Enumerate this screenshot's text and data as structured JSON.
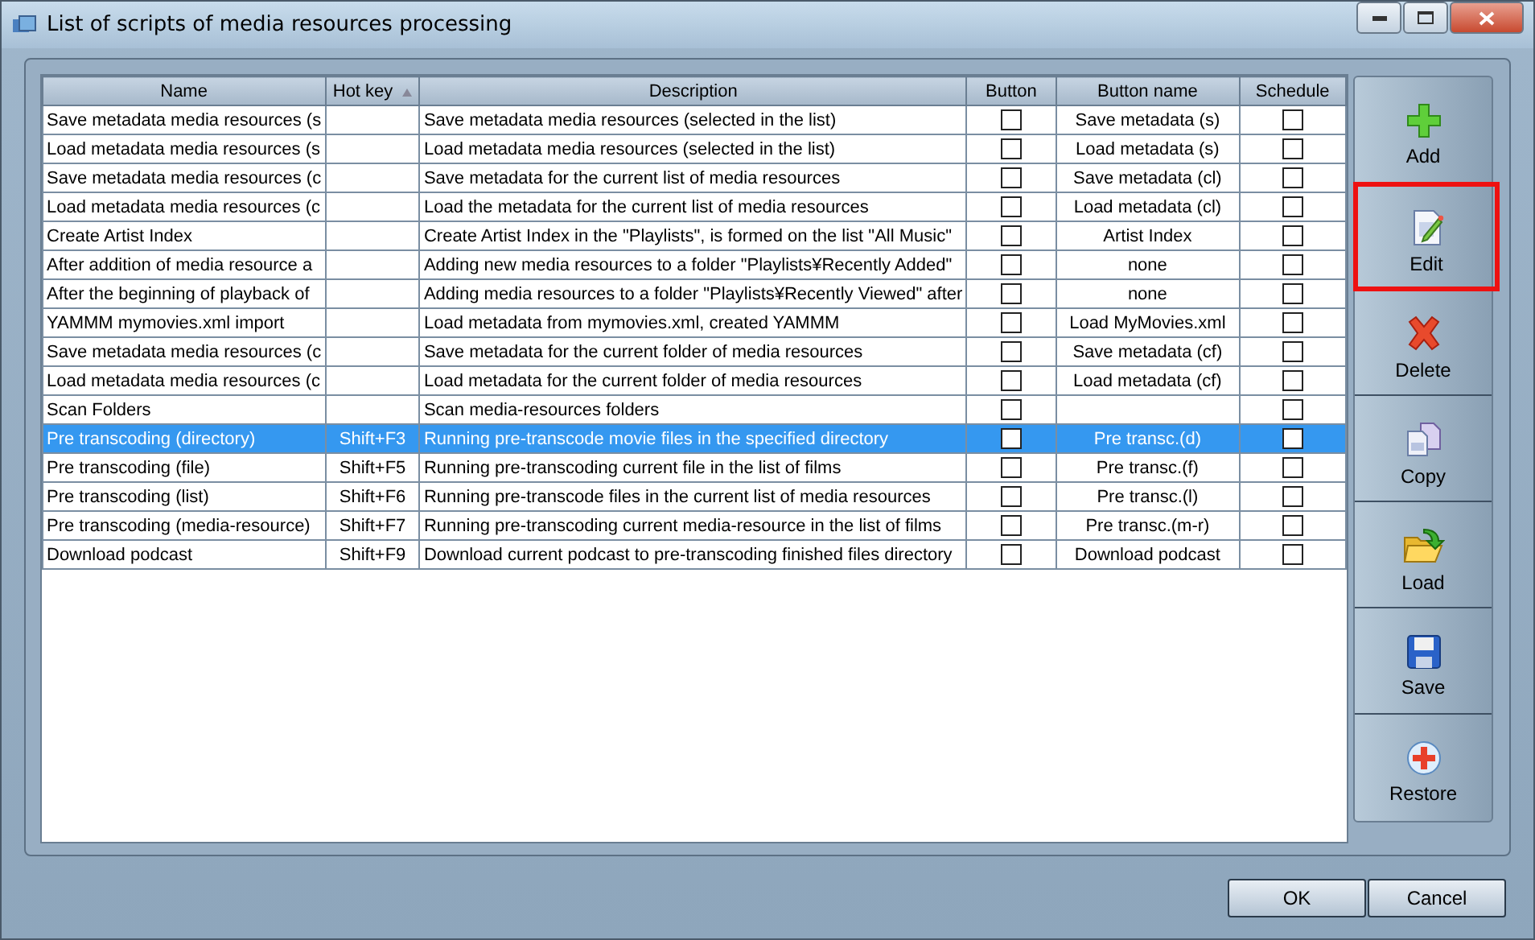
{
  "window": {
    "title": "List of scripts of media resources processing"
  },
  "table": {
    "columns": [
      {
        "label": "Name",
        "sorted": false
      },
      {
        "label": "Hot key",
        "sorted": true
      },
      {
        "label": "Description",
        "sorted": false
      },
      {
        "label": "Button",
        "sorted": false
      },
      {
        "label": "Button name",
        "sorted": false
      },
      {
        "label": "Schedule",
        "sorted": false
      }
    ],
    "rows": [
      {
        "name": "Save metadata media resources (s",
        "hotkey": "",
        "description": "Save metadata media resources (selected in the list)",
        "button": false,
        "button_name": "Save metadata (s)",
        "schedule": false,
        "selected": false
      },
      {
        "name": "Load metadata media resources (s",
        "hotkey": "",
        "description": "Load metadata media resources (selected in the list)",
        "button": false,
        "button_name": "Load metadata (s)",
        "schedule": false,
        "selected": false
      },
      {
        "name": "Save metadata media resources (c",
        "hotkey": "",
        "description": "Save metadata for the current list of media resources",
        "button": false,
        "button_name": "Save metadata (cl)",
        "schedule": false,
        "selected": false
      },
      {
        "name": "Load metadata media resources (c",
        "hotkey": "",
        "description": "Load the metadata for the current list of media resources",
        "button": false,
        "button_name": "Load metadata (cl)",
        "schedule": false,
        "selected": false
      },
      {
        "name": "Create Artist Index",
        "hotkey": "",
        "description": "Create Artist Index in the \"Playlists\", is formed on the list \"All Music\"",
        "button": false,
        "button_name": "Artist Index",
        "schedule": false,
        "selected": false
      },
      {
        "name": "After addition of media resource a",
        "hotkey": "",
        "description": "Adding new media resources to a folder \"Playlists¥Recently Added\"",
        "button": false,
        "button_name": "none",
        "schedule": false,
        "selected": false
      },
      {
        "name": "After the beginning of playback of",
        "hotkey": "",
        "description": "Adding media resources to a folder \"Playlists¥Recently Viewed\" after",
        "button": false,
        "button_name": "none",
        "schedule": false,
        "selected": false
      },
      {
        "name": "YAMMM mymovies.xml import",
        "hotkey": "",
        "description": "Load metadata from mymovies.xml, created YAMMM",
        "button": false,
        "button_name": "Load MyMovies.xml",
        "schedule": false,
        "selected": false
      },
      {
        "name": "Save metadata media resources (c",
        "hotkey": "",
        "description": "Save metadata for the current folder of media resources",
        "button": false,
        "button_name": "Save metadata (cf)",
        "schedule": false,
        "selected": false
      },
      {
        "name": "Load metadata media resources (c",
        "hotkey": "",
        "description": "Load metadata for the current folder of media resources",
        "button": false,
        "button_name": "Load metadata (cf)",
        "schedule": false,
        "selected": false
      },
      {
        "name": "Scan Folders",
        "hotkey": "",
        "description": "Scan media-resources folders",
        "button": false,
        "button_name": "",
        "schedule": false,
        "selected": false
      },
      {
        "name": "Pre transcoding (directory)",
        "hotkey": "Shift+F3",
        "description": "Running pre-transcode movie files in the specified directory",
        "button": false,
        "button_name": "Pre transc.(d)",
        "schedule": false,
        "selected": true
      },
      {
        "name": "Pre transcoding (file)",
        "hotkey": "Shift+F5",
        "description": "Running pre-transcoding current file in the list of films",
        "button": false,
        "button_name": "Pre transc.(f)",
        "schedule": false,
        "selected": false
      },
      {
        "name": "Pre transcoding (list)",
        "hotkey": "Shift+F6",
        "description": "Running pre-transcode files in the current list of media resources",
        "button": false,
        "button_name": "Pre transc.(l)",
        "schedule": false,
        "selected": false
      },
      {
        "name": "Pre transcoding (media-resource)",
        "hotkey": "Shift+F7",
        "description": "Running pre-transcoding current media-resource in the list of films",
        "button": false,
        "button_name": "Pre transc.(m-r)",
        "schedule": false,
        "selected": false
      },
      {
        "name": "Download podcast",
        "hotkey": "Shift+F9",
        "description": "Download current podcast to pre-transcoding finished files directory",
        "button": false,
        "button_name": "Download podcast",
        "schedule": false,
        "selected": false
      }
    ]
  },
  "toolbar": [
    {
      "kind": "add",
      "label": "Add",
      "highlighted": false
    },
    {
      "kind": "edit",
      "label": "Edit",
      "highlighted": true
    },
    {
      "kind": "delete",
      "label": "Delete",
      "highlighted": false
    },
    {
      "kind": "copy",
      "label": "Copy",
      "highlighted": false
    },
    {
      "kind": "load",
      "label": "Load",
      "highlighted": false
    },
    {
      "kind": "save",
      "label": "Save",
      "highlighted": false
    },
    {
      "kind": "restore",
      "label": "Restore",
      "highlighted": false
    }
  ],
  "buttons": [
    {
      "label": "OK"
    },
    {
      "label": "Cancel"
    }
  ]
}
